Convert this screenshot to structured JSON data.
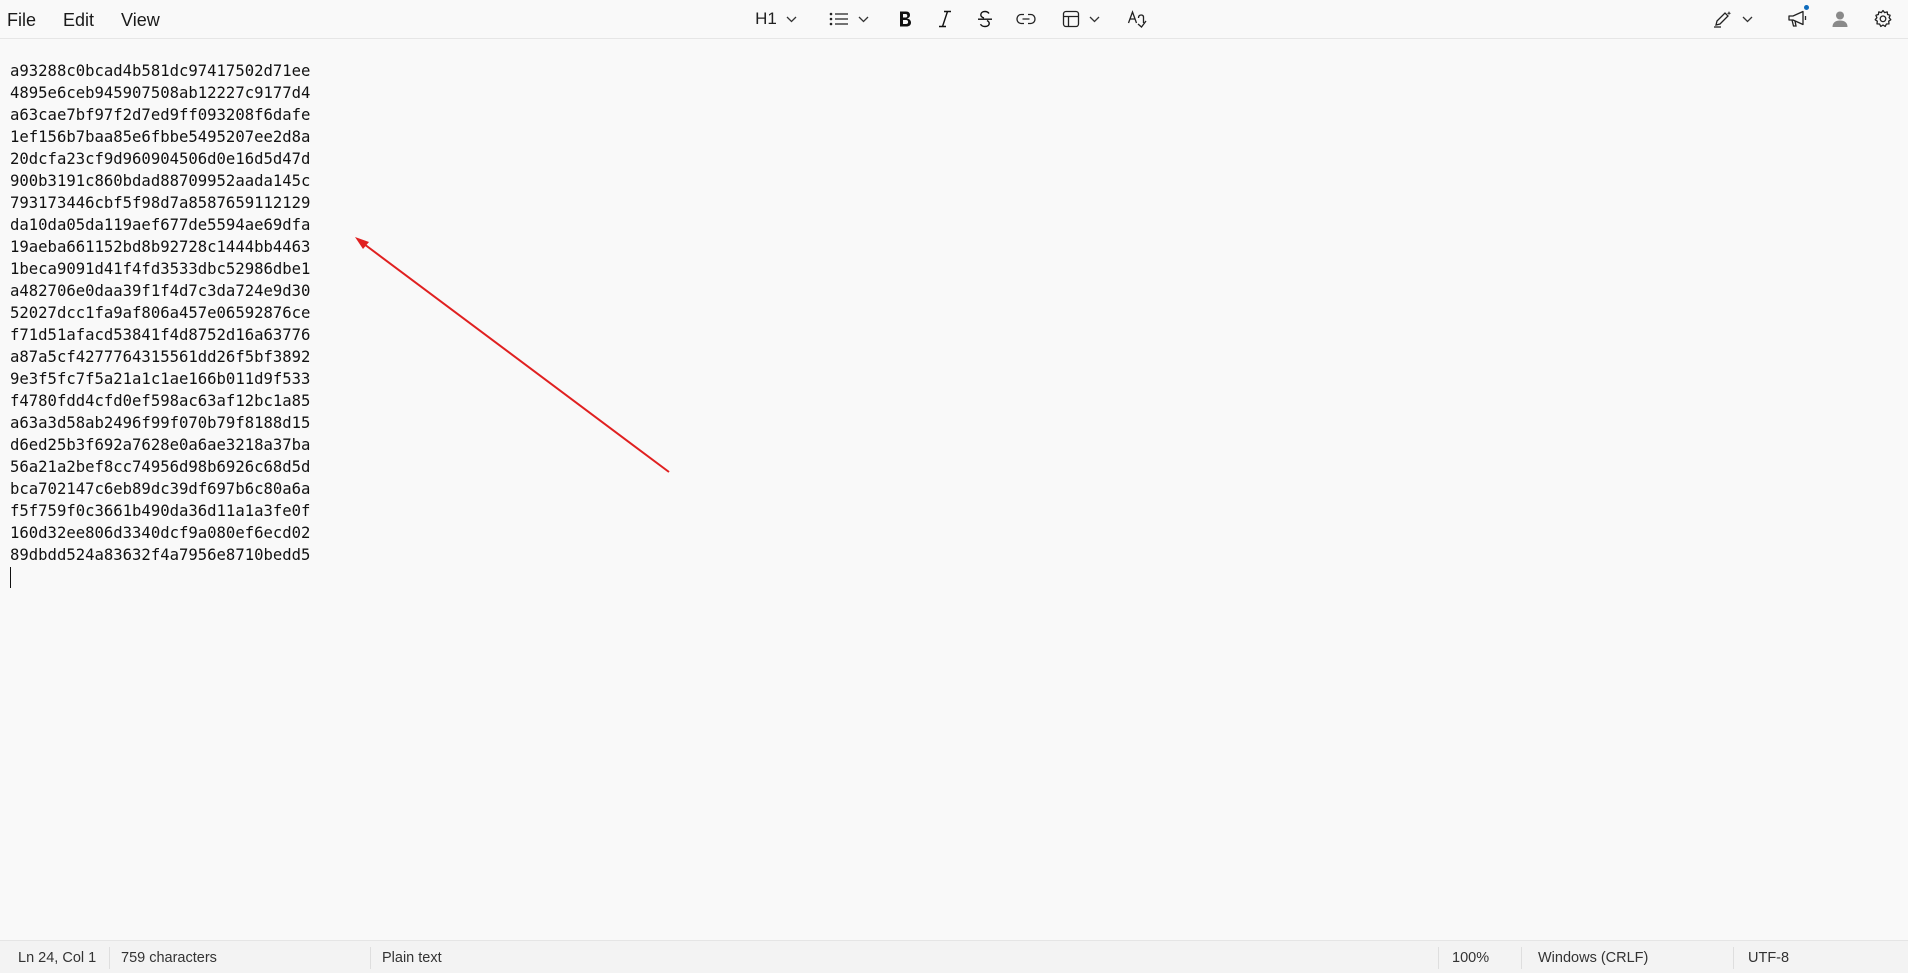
{
  "menu": {
    "file": "File",
    "edit": "Edit",
    "view": "View"
  },
  "toolbar": {
    "heading_label": "H1",
    "icons": [
      "chevron-down-icon",
      "bulleted-list-icon",
      "bold-icon",
      "italic-icon",
      "strikethrough-icon",
      "link-icon",
      "table-icon",
      "clear-formatting-icon",
      "copilot-pen-icon",
      "megaphone-icon",
      "account-icon",
      "gear-icon"
    ]
  },
  "editor": {
    "lines": [
      "a93288c0bcad4b581dc97417502d71ee",
      "4895e6ceb945907508ab12227c9177d4",
      "a63cae7bf97f2d7ed9ff093208f6dafe",
      "1ef156b7baa85e6fbbe5495207ee2d8a",
      "20dcfa23cf9d960904506d0e16d5d47d",
      "900b3191c860bdad88709952aada145c",
      "793173446cbf5f98d7a8587659112129",
      "da10da05da119aef677de5594ae69dfa",
      "19aeba661152bd8b92728c1444bb4463",
      "1beca9091d41f4fd3533dbc52986dbe1",
      "a482706e0daa39f1f4d7c3da724e9d30",
      "52027dcc1fa9af806a457e06592876ce",
      "f71d51afacd53841f4d8752d16a63776",
      "a87a5cf4277764315561dd26f5bf3892",
      "9e3f5fc7f5a21a1c1ae166b011d9f533",
      "f4780fdd4cfd0ef598ac63af12bc1a85",
      "a63a3d58ab2496f99f070b79f8188d15",
      "d6ed25b3f692a7628e0a6ae3218a37ba",
      "56a21a2bef8cc74956d98b6926c68d5d",
      "bca702147c6eb89dc39df697b6c80a6a",
      "f5f759f0c3661b490da36d11a1a3fe0f",
      "160d32ee806d3340dcf9a080ef6ecd02",
      "89dbdd524a83632f4a7956e8710bedd5"
    ]
  },
  "annotation": {
    "arrow_color": "#e02020"
  },
  "status": {
    "position": "Ln 24, Col 1",
    "characters": "759 characters",
    "format": "Plain text",
    "zoom": "100%",
    "line_ending": "Windows (CRLF)",
    "encoding": "UTF-8"
  },
  "colors": {
    "background": "#f9f9f9",
    "statusbar": "#f3f3f3",
    "notification_dot": "#0f6cbd"
  }
}
